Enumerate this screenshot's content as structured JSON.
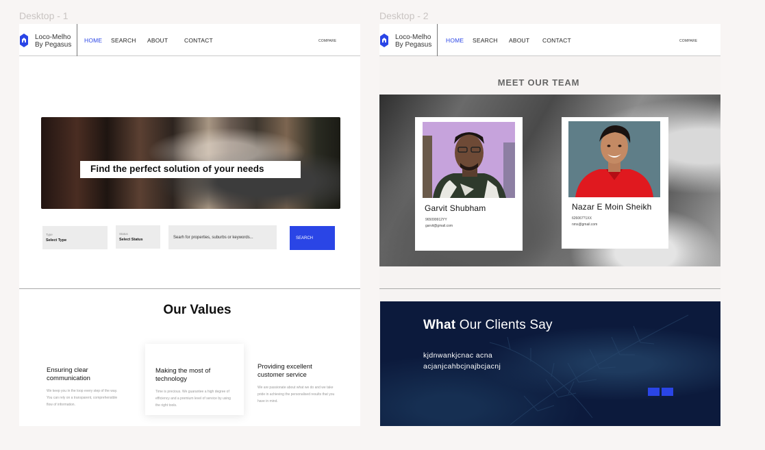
{
  "frames": [
    {
      "label": "Desktop - 1"
    },
    {
      "label": "Desktop - 2"
    }
  ],
  "brand": {
    "line1": "Loco-Melho",
    "line2": "By Pegasus"
  },
  "nav": {
    "home": "HOME",
    "search": "SEARCH",
    "about": "ABOUT",
    "contact": "CONTACT",
    "compare": "COMPARE"
  },
  "colors": {
    "accent": "#2a45e6",
    "navy": "#0c1a3c"
  },
  "hero": {
    "headline": "Find the perfect solution of your needs"
  },
  "filters": {
    "type_caption": "Type",
    "type_value": "Select Type",
    "status_caption": "Status",
    "status_value": "Select Status",
    "search_placeholder": "Searh for properties, suburbs or keywords...",
    "search_button": "SEARCH"
  },
  "values": {
    "title": "Our Values",
    "items": [
      {
        "title": "Ensuring clear communication",
        "text": "We keep you in the loop every step of the way. You can rely on a transparent, comprehensible flow of information."
      },
      {
        "title": "Making the most of technology",
        "text": "Time is precious. We guarantee a high degree of efficiency and a premium level of service by using the right tools."
      },
      {
        "title": "Providing excellent customer service",
        "text": "We are passionate about what we do and we take pride in achieving the personalised results that you have in mind."
      }
    ]
  },
  "team": {
    "title": "MEET OUR TEAM",
    "members": [
      {
        "name": "Garvit Shubham",
        "phone": "965099912YY",
        "email": "garvit@gmail.com"
      },
      {
        "name": "Nazar E Moin Sheikh",
        "phone": "626067?1XX",
        "email": "nms@gmail.com"
      }
    ]
  },
  "clients": {
    "title_bold": "What",
    "title_rest": " Our Clients Say",
    "text": "kjdnwankjcnac acna acjanjcahbcjnajbcjacnj"
  }
}
